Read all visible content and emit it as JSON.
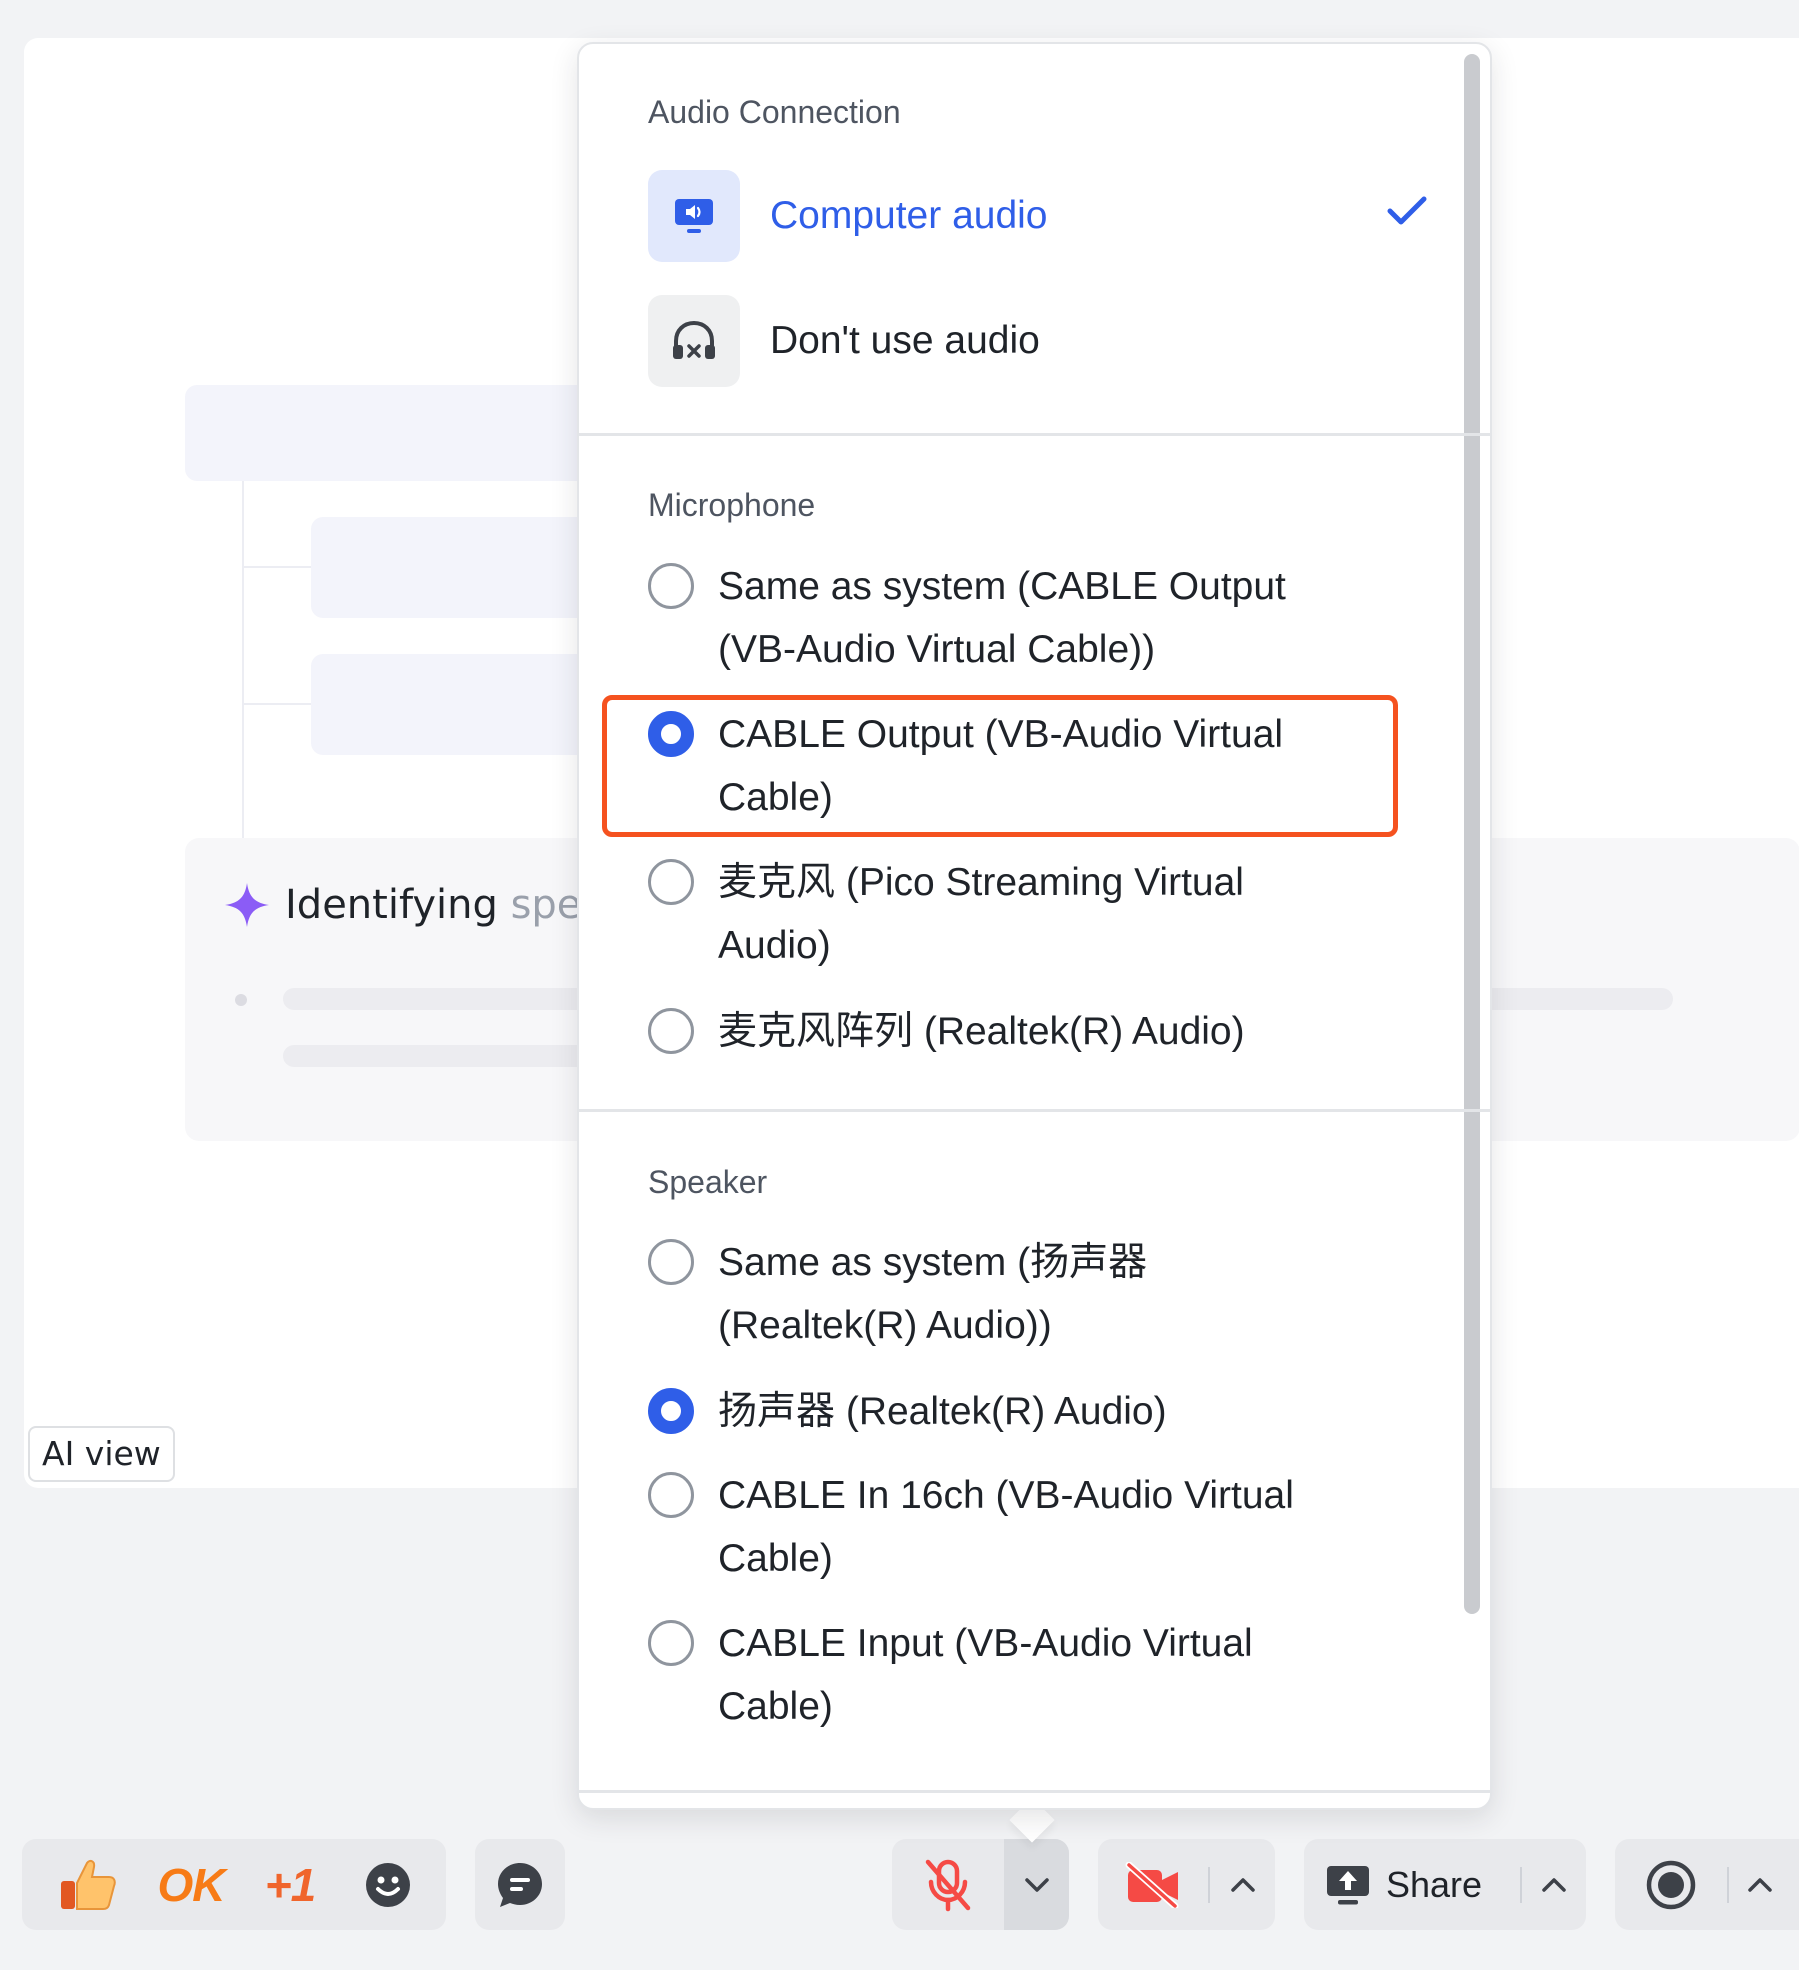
{
  "background": {
    "ai_card": {
      "title_visible": "Identifying",
      "title_faded": " speal"
    },
    "ai_view_button": "AI view"
  },
  "audio_panel": {
    "connection": {
      "title": "Audio Connection",
      "options": [
        {
          "label": "Computer audio",
          "icon": "monitor-speaker-icon",
          "selected": true
        },
        {
          "label": "Don't use audio",
          "icon": "headphones-off-icon",
          "selected": false
        }
      ]
    },
    "microphone": {
      "title": "Microphone",
      "options": [
        {
          "label": "Same as system (CABLE Output (VB-Audio Virtual Cable))",
          "selected": false
        },
        {
          "label": "CABLE Output (VB-Audio Virtual Cable)",
          "selected": true
        },
        {
          "label": "麦克风 (Pico Streaming Virtual Audio)",
          "selected": false
        },
        {
          "label": "麦克风阵列 (Realtek(R) Audio)",
          "selected": false
        }
      ]
    },
    "speaker": {
      "title": "Speaker",
      "options": [
        {
          "label": "Same as system (扬声器 (Realtek(R) Audio))",
          "selected": false
        },
        {
          "label": "扬声器 (Realtek(R) Audio)",
          "selected": true
        },
        {
          "label": "CABLE In 16ch (VB-Audio Virtual Cable)",
          "selected": false
        },
        {
          "label": "CABLE Input (VB-Audio Virtual Cable)",
          "selected": false
        }
      ]
    }
  },
  "toolbar": {
    "reactions": {
      "thumbs_up": "thumbs-up-icon",
      "ok": "OK",
      "plus_one": "+1",
      "emoji": "emoji-icon"
    },
    "chat": "chat-icon",
    "mic": "mic-muted-icon",
    "camera": "camera-off-icon",
    "share_label": "Share",
    "record": "record-icon"
  },
  "colors": {
    "accent": "#2f5ee8",
    "highlight_border": "#f5521f",
    "muted_red": "#f54a45",
    "reaction_orange": "#f77b16",
    "ai_sparkle": "#8b5cf6"
  }
}
